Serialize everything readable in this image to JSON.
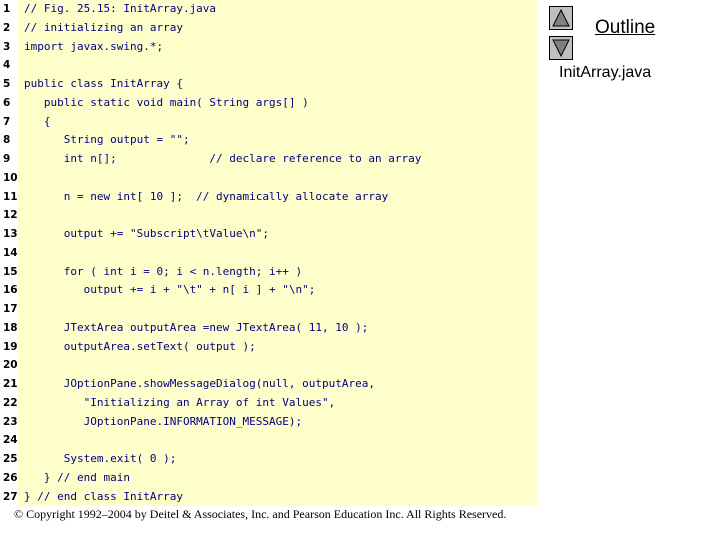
{
  "outline": {
    "title": "Outline",
    "file": "InitArray.java",
    "up_icon": "triangle-up-icon",
    "down_icon": "triangle-down-icon"
  },
  "code": {
    "lines": [
      {
        "n": "1",
        "text": "// Fig. 25.15: InitArray.java"
      },
      {
        "n": "2",
        "text": "// initializing an array"
      },
      {
        "n": "3",
        "text": "import javax.swing.*;"
      },
      {
        "n": "4",
        "text": ""
      },
      {
        "n": "5",
        "text": "public class InitArray {"
      },
      {
        "n": "6",
        "text": "   public static void main( String args[] )"
      },
      {
        "n": "7",
        "text": "   {"
      },
      {
        "n": "8",
        "text": "      String output = \"\";"
      },
      {
        "n": "9",
        "text": "      int n[];              // declare reference to an array"
      },
      {
        "n": "10",
        "text": ""
      },
      {
        "n": "11",
        "text": "      n = new int[ 10 ];  // dynamically allocate array"
      },
      {
        "n": "12",
        "text": ""
      },
      {
        "n": "13",
        "text": "      output += \"Subscript\\tValue\\n\";"
      },
      {
        "n": "14",
        "text": ""
      },
      {
        "n": "15",
        "text": "      for ( int i = 0; i < n.length; i++ )"
      },
      {
        "n": "16",
        "text": "         output += i + \"\\t\" + n[ i ] + \"\\n\";"
      },
      {
        "n": "17",
        "text": ""
      },
      {
        "n": "18",
        "text": "      JTextArea outputArea =new JTextArea( 11, 10 );"
      },
      {
        "n": "19",
        "text": "      outputArea.setText( output );"
      },
      {
        "n": "20",
        "text": ""
      },
      {
        "n": "21",
        "text": "      JOptionPane.showMessageDialog(null, outputArea,"
      },
      {
        "n": "22",
        "text": "         \"Initializing an Array of int Values\","
      },
      {
        "n": "23",
        "text": "         JOptionPane.INFORMATION_MESSAGE);"
      },
      {
        "n": "24",
        "text": ""
      },
      {
        "n": "25",
        "text": "      System.exit( 0 );"
      },
      {
        "n": "26",
        "text": "   } // end main"
      },
      {
        "n": "27",
        "text": "} // end class InitArray"
      }
    ]
  },
  "footer": {
    "copyright": "© Copyright 1992–2004 by Deitel & Associates, Inc. and Pearson Education Inc. All Rights Reserved."
  }
}
